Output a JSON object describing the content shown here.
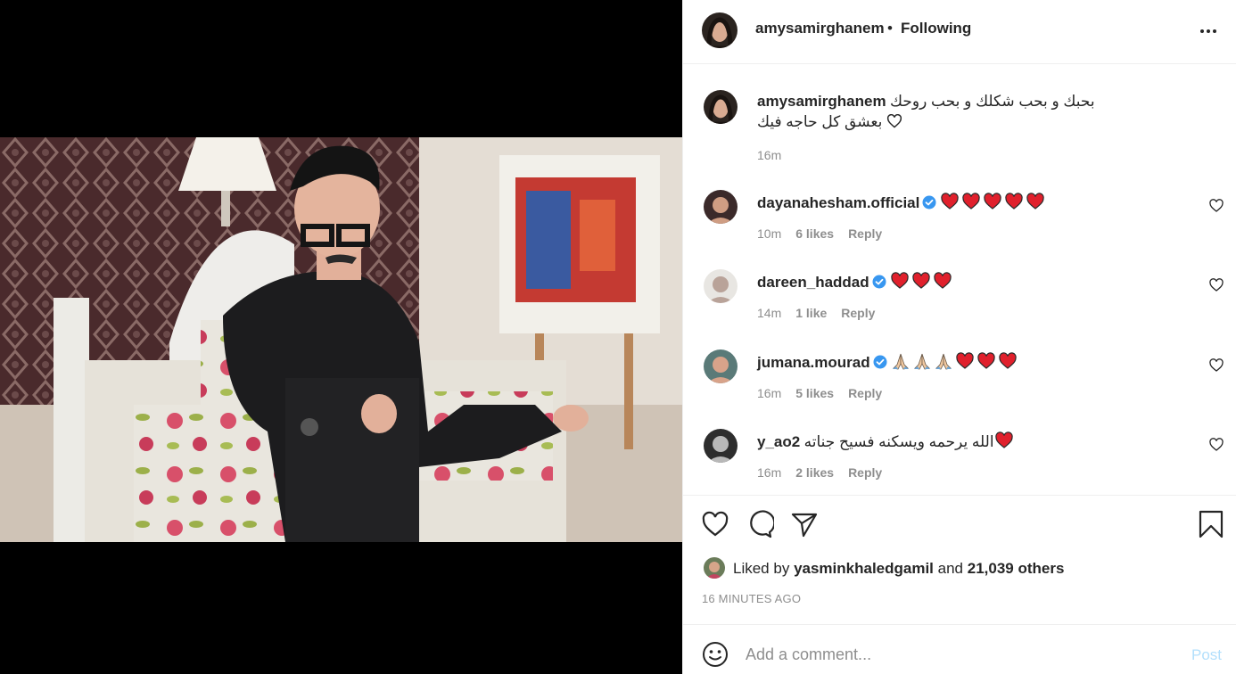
{
  "post": {
    "author": "amysamirghanem",
    "separator": "•",
    "follow_status": "Following",
    "caption_line1": "بحبك و بحب شكلك و بحب روحك",
    "caption_line2": "بعشق كل حاجه فيك",
    "caption_time": "16m"
  },
  "comments": [
    {
      "user": "dayanahesham.official",
      "verified": true,
      "hearts": 5,
      "prayers": 0,
      "text": "",
      "time": "10m",
      "likes": "6 likes",
      "reply": "Reply"
    },
    {
      "user": "dareen_haddad",
      "verified": true,
      "hearts": 3,
      "prayers": 0,
      "text": "",
      "time": "14m",
      "likes": "1 like",
      "reply": "Reply"
    },
    {
      "user": "jumana.mourad",
      "verified": true,
      "hearts": 3,
      "prayers": 3,
      "text": "",
      "time": "16m",
      "likes": "5 likes",
      "reply": "Reply"
    },
    {
      "user": "y_ao2",
      "verified": false,
      "hearts": 1,
      "prayers": 0,
      "text": "الله يرحمه ويسكنه فسيح جناته",
      "time": "16m",
      "likes": "2 likes",
      "reply": "Reply"
    }
  ],
  "likes": {
    "prefix": "Liked by",
    "user": "yasminkhaledgamil",
    "and": "and",
    "count": "21,039 others"
  },
  "timestamp": "16 MINUTES AGO",
  "add_comment": {
    "placeholder": "Add a comment...",
    "post_label": "Post"
  },
  "colors": {
    "verified": "#3897f0",
    "heart": "#ed4956",
    "post_disabled": "#b2dffc",
    "muted": "#8e8e8e"
  },
  "icons": [
    "more-icon",
    "heart-icon",
    "comment-icon",
    "share-icon",
    "bookmark-icon",
    "smiley-icon",
    "verified-icon"
  ]
}
